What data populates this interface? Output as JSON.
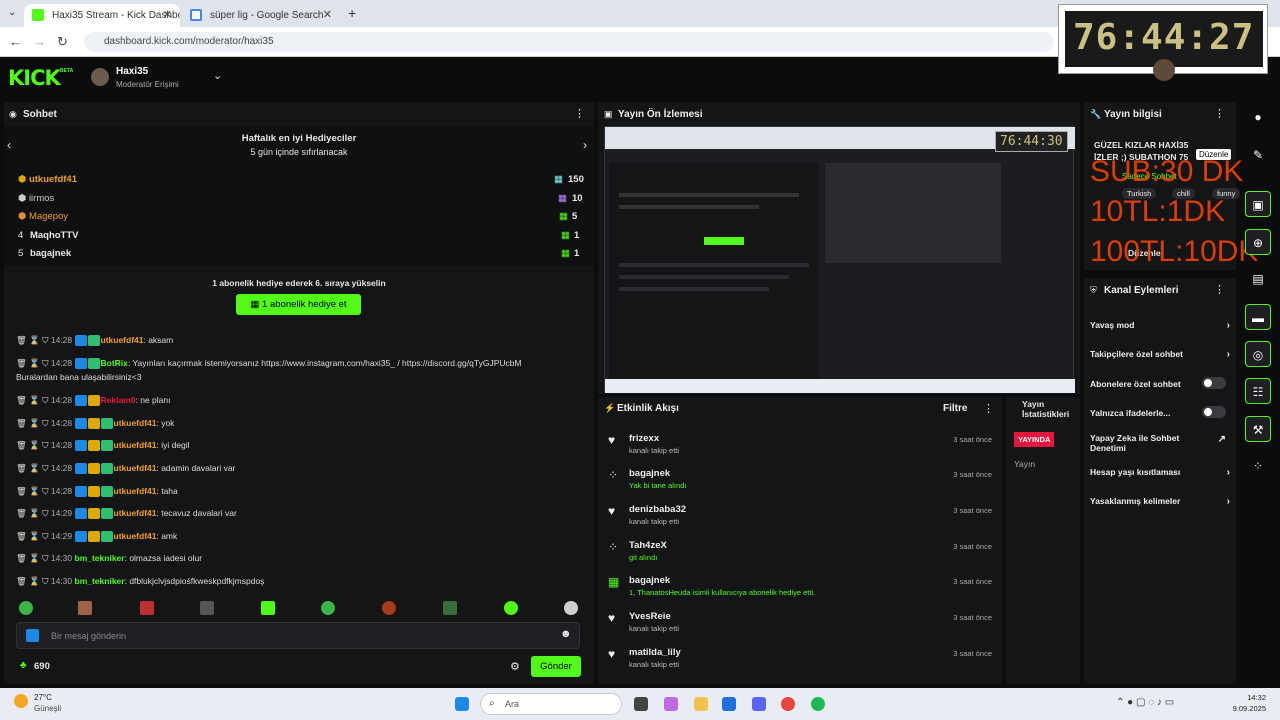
{
  "browser": {
    "tabs": [
      {
        "title": "Haxi35 Stream - Kick Dashboard"
      },
      {
        "title": "süper lig - Google Search"
      }
    ],
    "new_tab": "+",
    "url": "dashboard.kick.com/moderator/haxi35"
  },
  "timer_overlay": "76:44:27",
  "header": {
    "logo": "KICK",
    "logo_tag": "BETA",
    "channel": "Haxi35",
    "role": "Moderatör Erişimi"
  },
  "chat": {
    "title": "Sohbet",
    "leaderboard": {
      "title": "Haftalık en iyi Hediyeciler",
      "subtitle": "5 gün içinde sıfırlanacak",
      "entries": [
        {
          "rank": "1",
          "name": "utkuefdf41",
          "count": "150"
        },
        {
          "rank": "2",
          "name": "iirmos",
          "count": "10"
        },
        {
          "rank": "3",
          "name": "Magepoy",
          "count": "5"
        },
        {
          "rank": "4",
          "name": "MaqhoTTV",
          "count": "1"
        },
        {
          "rank": "5",
          "name": "bagajnek",
          "count": "1"
        }
      ]
    },
    "promo_text": "1 abonelik hediye ederek 6. sıraya yükselin",
    "promo_button": "1 abonelik hediye et",
    "messages": [
      {
        "time": "14:28",
        "user": "utkuefdf41",
        "text": ": aksam"
      },
      {
        "time": "14:28",
        "user": "BotRix",
        "text": ": Yayınları kaçırmak istemiyorsanız https://www.instagram.com/haxi35_ / https://discord.gg/qTyGJPUcbM",
        "cont": "Buralardan bana ulaşabilirsiniz<3"
      },
      {
        "time": "14:28",
        "user": "Reklam0",
        "text": ": ne planı"
      },
      {
        "time": "14:28",
        "user": "utkuefdf41",
        "text": ": yok"
      },
      {
        "time": "14:28",
        "user": "utkuefdf41",
        "text": ": iyi degil"
      },
      {
        "time": "14:28",
        "user": "utkuefdf41",
        "text": ": adamin davalari var"
      },
      {
        "time": "14:28",
        "user": "utkuefdf41",
        "text": ": taha"
      },
      {
        "time": "14:29",
        "user": "utkuefdf41",
        "text": ": tecavuz davalari var"
      },
      {
        "time": "14:29",
        "user": "utkuefdf41",
        "text": ": amk"
      },
      {
        "time": "14:30",
        "user": "bm_tekniker",
        "text": ": olmazsa iadesi olur"
      },
      {
        "time": "14:30",
        "user": "bm_tekniker",
        "text": ": dfblukjclvjsdpiośfkweskpdfkjmspdoş"
      }
    ],
    "input_placeholder": "Bir mesaj gönderin",
    "points": "690",
    "send_label": "Gönder"
  },
  "preview": {
    "title": "Yayın Ön İzlemesi",
    "inner_timer": "76:44:30"
  },
  "activity": {
    "title": "Etkinlik Akışı",
    "filter": "Filtre",
    "items": [
      {
        "name": "frizexx",
        "sub": "kanalı takip etti",
        "time": "3 saat önce",
        "icon": "heart-icon"
      },
      {
        "name": "bagajnek",
        "sub": "Yak bi tane alındı",
        "time": "3 saat önce",
        "icon": "redeem-icon"
      },
      {
        "name": "denizbaba32",
        "sub": "kanalı takip etti",
        "time": "3 saat önce",
        "icon": "heart-icon"
      },
      {
        "name": "Tah4zeX",
        "sub": "git alındı",
        "time": "3 saat önce",
        "icon": "redeem-icon"
      },
      {
        "name": "bagajnek",
        "sub": "1, ThanatosHeuda isimli kullanıcıya abonelik hediye etti.",
        "time": "3 saat önce",
        "icon": "gift-icon"
      },
      {
        "name": "YvesReie",
        "sub": "kanalı takip etti",
        "time": "3 saat önce",
        "icon": "heart-icon"
      },
      {
        "name": "matilda_lily",
        "sub": "kanalı takip etti",
        "time": "3 saat önce",
        "icon": "heart-icon"
      }
    ]
  },
  "stats": {
    "title": "Yayın İstatistikleri",
    "status_badge": "YAYINDA",
    "label": "Yayın"
  },
  "stream_info": {
    "title": "Yayın bilgisi",
    "stream_title": "GÜZEL KIZLAR HAXİ35 İZLER ;) SUBATHON 75",
    "edit": "Düzenle",
    "category": "Sadece Sohbet",
    "tags": [
      "Turkish",
      "chill",
      "funny"
    ],
    "more": "Düzenle"
  },
  "overlay_text": [
    "SUB:30 DK",
    "10TL:1DK",
    "100TL:10DK"
  ],
  "channel_actions": {
    "title": "Kanal Eylemleri",
    "items": [
      {
        "label": "Yavaş mod",
        "kind": "chevron"
      },
      {
        "label": "Takipçilere özel sohbet",
        "kind": "chevron"
      },
      {
        "label": "Abonelere özel sohbet",
        "kind": "toggle"
      },
      {
        "label": "Yalnızca ifadelerle...",
        "kind": "toggle"
      },
      {
        "label": "Yapay Zeka ile Sohbet Denetimi",
        "kind": "external"
      },
      {
        "label": "Hesap yaşı kısıtlaması",
        "kind": "chevron"
      },
      {
        "label": "Yasaklanmış kelimeler",
        "kind": "chevron"
      }
    ]
  },
  "taskbar": {
    "weather_temp": "27°C",
    "weather_desc": "Güneşli",
    "search_placeholder": "Ara",
    "time": "14:32",
    "date": "9.09.2025"
  },
  "colors": {
    "brand": "#53fc18",
    "live": "#e5163d",
    "overlay_red": "#ff4400"
  }
}
